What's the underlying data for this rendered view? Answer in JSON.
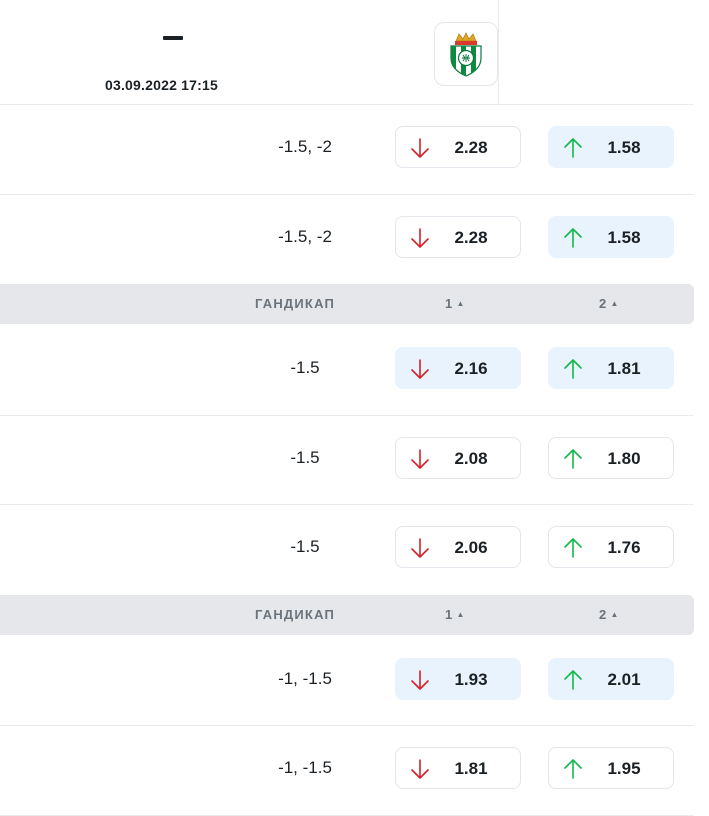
{
  "match": {
    "score_separator": "–",
    "datetime": "03.09.2022 17:15",
    "away_logo_icon": "real-betis-crest-icon"
  },
  "colors": {
    "down_arrow": "#d6202a",
    "up_arrow": "#12b94a",
    "highlight_bg": "#e8f3fd",
    "section_bg": "#e5e7ea"
  },
  "groups": [
    {
      "rows": [
        {
          "handicap": "-1.5, -2",
          "odd1": "2.28",
          "odd2": "1.58",
          "trend1": "down",
          "trend2": "up",
          "hl1": false,
          "hl2": true
        },
        {
          "handicap": "-1.5, -2",
          "odd1": "2.28",
          "odd2": "1.58",
          "trend1": "down",
          "trend2": "up",
          "hl1": false,
          "hl2": true
        }
      ]
    },
    {
      "header": {
        "label": "ГАНДИКАП",
        "col1": "1",
        "col2": "2"
      },
      "rows": [
        {
          "handicap": "-1.5",
          "odd1": "2.16",
          "odd2": "1.81",
          "trend1": "down",
          "trend2": "up",
          "hl1": true,
          "hl2": true
        },
        {
          "handicap": "-1.5",
          "odd1": "2.08",
          "odd2": "1.80",
          "trend1": "down",
          "trend2": "up",
          "hl1": false,
          "hl2": false
        },
        {
          "handicap": "-1.5",
          "odd1": "2.06",
          "odd2": "1.76",
          "trend1": "down",
          "trend2": "up",
          "hl1": false,
          "hl2": false
        }
      ]
    },
    {
      "header": {
        "label": "ГАНДИКАП",
        "col1": "1",
        "col2": "2"
      },
      "rows": [
        {
          "handicap": "-1, -1.5",
          "odd1": "1.93",
          "odd2": "2.01",
          "trend1": "down",
          "trend2": "up",
          "hl1": true,
          "hl2": true
        },
        {
          "handicap": "-1, -1.5",
          "odd1": "1.81",
          "odd2": "1.95",
          "trend1": "down",
          "trend2": "up",
          "hl1": false,
          "hl2": false
        }
      ]
    }
  ]
}
